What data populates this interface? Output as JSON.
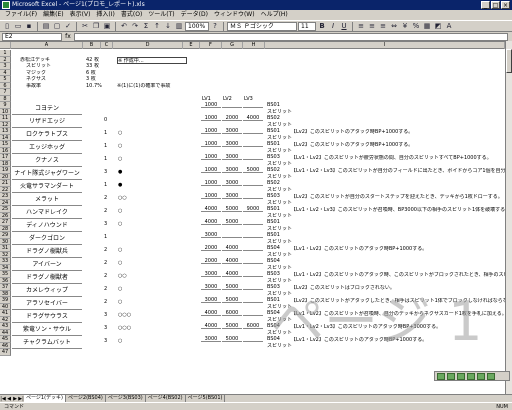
{
  "window": {
    "title": "Microsoft Excel - ページ1(プロモ_レポート).xls"
  },
  "menu": [
    "ファイル(F)",
    "編集(E)",
    "表示(V)",
    "挿入(I)",
    "書式(O)",
    "ツール(T)",
    "データ(D)",
    "ウィンドウ(W)",
    "ヘルプ(H)"
  ],
  "toolbar": {
    "zoom": "100%",
    "font": "ＭＳ Ｐゴシック",
    "size": "11"
  },
  "formula": {
    "cell_ref": "E2",
    "fx": "fx",
    "value": ""
  },
  "columns": [
    "A",
    "B",
    "C",
    "D",
    "E",
    "F",
    "G",
    "H",
    "I",
    "J"
  ],
  "summary": {
    "title": "赤松江デッキ",
    "title_val": "42 枚",
    "rows": [
      {
        "label": "スピリット",
        "value": "33 枚"
      },
      {
        "label": "マジック",
        "value": "6 枚"
      },
      {
        "label": "ネクサス",
        "value": "3 枚"
      },
      {
        "label": "事故率",
        "value": "10.7%"
      }
    ],
    "note": "※ 作成中…",
    "footnote": "※(1)に(1)の確率で事故"
  },
  "lv_headers": [
    "LV1",
    "LV2",
    "LV3"
  ],
  "cards": [
    {
      "row": "9",
      "name": "コヨテン",
      "cost": "",
      "attr": "",
      "marks": "",
      "lv": [
        "1000",
        "",
        ""
      ],
      "code": "BS01",
      "type": "スピリット",
      "effect": ""
    },
    {
      "row": "11",
      "name": "リザドエッジ",
      "cost": "0",
      "attr": "",
      "marks": "",
      "lv": [
        "1000",
        "2000",
        "4000"
      ],
      "code": "BS02",
      "type": "スピリット",
      "effect": ""
    },
    {
      "row": "13",
      "name": "ロクケラトプス",
      "cost": "1",
      "attr": "",
      "marks": "○",
      "lv": [
        "1000",
        "3000",
        ""
      ],
      "code": "BS01",
      "type": "スピリット",
      "effect": "【Lv2】このスピリットのアタック時BP+1000する。"
    },
    {
      "row": "15",
      "name": "エッジホッグ",
      "cost": "1",
      "attr": "",
      "marks": "○",
      "lv": [
        "1000",
        "3000",
        ""
      ],
      "code": "BS01",
      "type": "スピリット",
      "effect": "【Lv2】このスピリットのアタック時BP+1000する。"
    },
    {
      "row": "17",
      "name": "クナノス",
      "cost": "1",
      "attr": "",
      "marks": "○",
      "lv": [
        "1000",
        "3000",
        ""
      ],
      "code": "BS03",
      "type": "スピリット",
      "effect": "【Lv1・Lv2】このスピリットが疲労状態の間、自分のスピリットすべてBP+1000する。"
    },
    {
      "row": "19",
      "name": "ナイト隊式ジャグワーン",
      "cost": "3",
      "attr": "",
      "marks": "●",
      "lv": [
        "1000",
        "3000",
        "5000"
      ],
      "code": "BS02",
      "type": "スピリット",
      "effect": "【Lv1・Lv2・Lv3】このスピリットが自分のフィールドに出たとき、ボイドからコア1個を自分のリザーブに置く。"
    },
    {
      "row": "21",
      "name": "火竜サラマンダート",
      "cost": "1",
      "attr": "",
      "marks": "●",
      "lv": [
        "1000",
        "3000",
        ""
      ],
      "code": "BS02",
      "type": "スピリット",
      "effect": ""
    },
    {
      "row": "23",
      "name": "メラット",
      "cost": "2",
      "attr": "",
      "marks": "○○",
      "lv": [
        "1000",
        "3000",
        ""
      ],
      "code": "BS03",
      "type": "スピリット",
      "effect": "【Lv2】このスピリットが自分のスタートステップを迎えたとき、デッキから1枚ドローする。"
    },
    {
      "row": "25",
      "name": "ハンマドレイク",
      "cost": "2",
      "attr": "",
      "marks": "○",
      "lv": [
        "4000",
        "5000",
        "9000"
      ],
      "code": "BS01",
      "type": "スピリット",
      "effect": "【Lv1・Lv2・Lv3】このスピリットが召喚時、BP3000以下の相手のスピリット1体を破壊する。"
    },
    {
      "row": "27",
      "name": "ディノハウンド",
      "cost": "3",
      "attr": "",
      "marks": "○",
      "lv": [
        "4000",
        "5000",
        ""
      ],
      "code": "BS01",
      "type": "スピリット",
      "effect": ""
    },
    {
      "row": "29",
      "name": "ダークゴロン",
      "cost": "1",
      "attr": "",
      "marks": "",
      "lv": [
        "3000",
        "",
        ""
      ],
      "code": "BS01",
      "type": "スピリット",
      "effect": ""
    },
    {
      "row": "31",
      "name": "ドラグノ樹獣兵",
      "cost": "2",
      "attr": "",
      "marks": "○",
      "lv": [
        "2000",
        "4000",
        ""
      ],
      "code": "BS04",
      "type": "スピリット",
      "effect": "【Lv1・Lv2】このスピリットのアタック時BP+1000する。"
    },
    {
      "row": "33",
      "name": "アイバーン",
      "cost": "2",
      "attr": "",
      "marks": "○",
      "lv": [
        "2000",
        "4000",
        ""
      ],
      "code": "BS04",
      "type": "スピリット",
      "effect": ""
    },
    {
      "row": "35",
      "name": "ドラグノ樹獣者",
      "cost": "2",
      "attr": "",
      "marks": "○○",
      "lv": [
        "3000",
        "4000",
        ""
      ],
      "code": "BS03",
      "type": "スピリット",
      "effect": "【Lv1・Lv2】このスピリットのアタック時、このスピリットがブロックされたとき、相手のスピリット1体を破壊する。"
    },
    {
      "row": "37",
      "name": "カメレウィップ",
      "cost": "2",
      "attr": "",
      "marks": "○",
      "lv": [
        "3000",
        "5000",
        ""
      ],
      "code": "BS03",
      "type": "スピリット",
      "effect": "【Lv2】このスピリットはブロックされない。"
    },
    {
      "row": "39",
      "name": "アラソセイバー",
      "cost": "2",
      "attr": "",
      "marks": "○",
      "lv": [
        "3000",
        "5000",
        ""
      ],
      "code": "BS01",
      "type": "スピリット",
      "effect": "【Lv2】このスピリットがアタックしたとき、相手はスピリット1体でブロックしなければならない。"
    },
    {
      "row": "41",
      "name": "ドラグサウラス",
      "cost": "3",
      "attr": "",
      "marks": "○○○",
      "lv": [
        "4000",
        "6000",
        ""
      ],
      "code": "BS04",
      "type": "スピリット",
      "effect": "【Lv1・Lv2】このスピリットが召喚時、自分のデッキからネクサスカード1枚を手札に加える。"
    },
    {
      "row": "43",
      "name": "紫竜ソン・サウル",
      "cost": "3",
      "attr": "",
      "marks": "○○○",
      "lv": [
        "4000",
        "5000",
        "6000"
      ],
      "code": "BS04",
      "type": "スピリット",
      "effect": "【Lv1・Lv2・Lv3】このスピリットのアタック時BP+3000する。"
    },
    {
      "row": "45",
      "name": "チャクラムバット",
      "cost": "3",
      "attr": "",
      "marks": "○",
      "lv": [
        "3000",
        "5000",
        ""
      ],
      "code": "BS04",
      "type": "スピリット",
      "effect": "【Lv1・Lv2】このスピリットのアタック時BP+1000する。"
    }
  ],
  "watermark": "ページ 1",
  "tabs": [
    "ページ1(デッキ)",
    "ページ2(BS04)",
    "ページ3(BS03)",
    "ページ4(BS02)",
    "ページ5(BS01)"
  ],
  "status": {
    "left": "コマンド",
    "right": "NUM"
  }
}
